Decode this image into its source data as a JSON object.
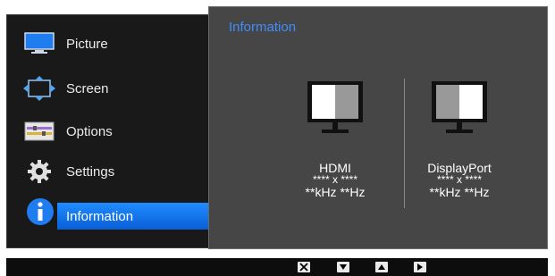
{
  "menu": {
    "items": [
      {
        "label": "Picture",
        "icon": "picture-icon"
      },
      {
        "label": "Screen",
        "icon": "screen-icon"
      },
      {
        "label": "Options",
        "icon": "options-icon"
      },
      {
        "label": "Settings",
        "icon": "settings-gear-icon"
      },
      {
        "label": "Information",
        "icon": "information-icon"
      }
    ],
    "selected_index": 4
  },
  "info": {
    "title": "Information",
    "title_color": "#3f8cff",
    "ports": [
      {
        "name": "HDMI",
        "resolution": "**** x ****",
        "frequency": "**kHz **Hz"
      },
      {
        "name": "DisplayPort",
        "resolution": "**** x ****",
        "frequency": "**kHz **Hz"
      }
    ]
  },
  "bottom_bar": {
    "keys": [
      "close-key-icon",
      "down-key-icon",
      "up-key-icon",
      "right-key-icon"
    ]
  }
}
